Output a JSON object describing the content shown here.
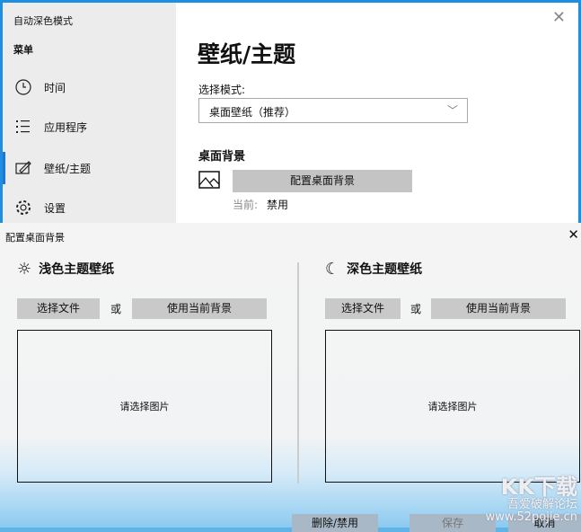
{
  "app": {
    "title": "自动深色模式",
    "menu_heading": "菜单",
    "nav": [
      {
        "label": "时间",
        "icon": "clock-icon"
      },
      {
        "label": "应用程序",
        "icon": "list-icon"
      },
      {
        "label": "壁纸/主题",
        "icon": "edit-icon",
        "active": true
      },
      {
        "label": "设置",
        "icon": "gear-icon"
      }
    ]
  },
  "main": {
    "title": "壁纸/主题",
    "mode_label": "选择模式:",
    "mode_value": "桌面壁纸（推荐）",
    "section": "桌面背景",
    "configure_label": "配置桌面背景",
    "current_label": "当前:",
    "current_value": "禁用"
  },
  "dialog": {
    "title": "配置桌面背景",
    "light": {
      "title": "浅色主题壁纸",
      "choose": "选择文件",
      "or": "或",
      "use_current": "使用当前背景",
      "placeholder": "请选择图片"
    },
    "dark": {
      "title": "深色主题壁纸",
      "choose": "选择文件",
      "or": "或",
      "use_current": "使用当前背景",
      "placeholder": "请选择图片"
    },
    "delete": "删除/禁用",
    "save": "保存",
    "cancel": "取消"
  },
  "watermark": {
    "line1": "KK下载",
    "line2": "吾爱破解论坛",
    "line3": "www.52pojie.cn"
  }
}
